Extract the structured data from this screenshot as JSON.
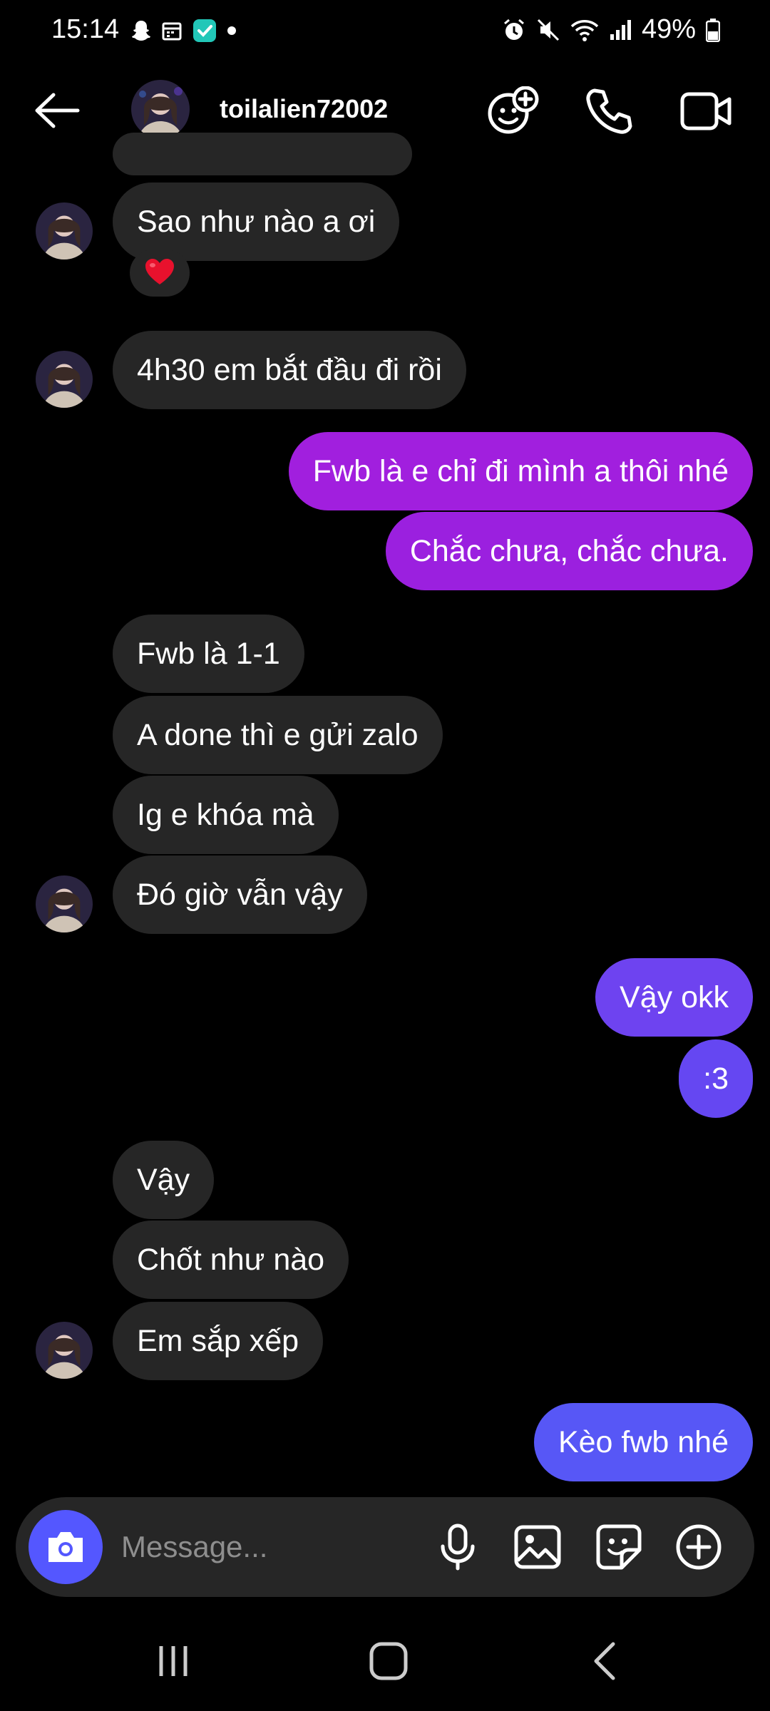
{
  "status_bar": {
    "time": "15:14",
    "battery": "49%",
    "left_icons": [
      "snapchat-icon",
      "calendar-icon",
      "check-app-icon",
      "dot-icon"
    ],
    "right_icons": [
      "alarm-icon",
      "mute-icon",
      "wifi-icon",
      "signal-icon",
      "battery-icon"
    ]
  },
  "header": {
    "username": "toilalien72002",
    "icons": [
      "back-arrow-icon",
      "add-people-icon",
      "phone-icon",
      "video-icon"
    ]
  },
  "colors": {
    "background": "#000000",
    "incoming_bubble": "#262626",
    "outgoing_purple": "#a11fde",
    "outgoing_violet": "#6e43f0",
    "outgoing_blue": "#5757f6",
    "camera_button": "#5457ff",
    "reaction": "#e8112d"
  },
  "messages": [
    {
      "direction": "in",
      "text": "Sao như nào a ơi",
      "reaction": "❤️"
    },
    {
      "direction": "in",
      "text": "4h30 em bắt đầu đi rồi"
    },
    {
      "direction": "out",
      "text": "Fwb là e chỉ đi mình a thôi nhé"
    },
    {
      "direction": "out",
      "text": "Chắc chưa, chắc chưa."
    },
    {
      "direction": "in",
      "text": "Fwb là 1-1"
    },
    {
      "direction": "in",
      "text": "A done thì e gửi zalo"
    },
    {
      "direction": "in",
      "text": "Ig e khóa mà"
    },
    {
      "direction": "in",
      "text": "Đó giờ vẫn vậy"
    },
    {
      "direction": "out",
      "text": "Vậy okk"
    },
    {
      "direction": "out",
      "text": ":3"
    },
    {
      "direction": "in",
      "text": "Vậy"
    },
    {
      "direction": "in",
      "text": "Chốt như nào"
    },
    {
      "direction": "in",
      "text": "Em sắp xếp"
    },
    {
      "direction": "out",
      "text": "Kèo fwb nhé"
    }
  ],
  "composer": {
    "placeholder": "Message...",
    "icons": [
      "camera-icon",
      "microphone-icon",
      "gallery-icon",
      "sticker-icon",
      "plus-circle-icon"
    ]
  },
  "navbar": {
    "icons": [
      "recent-apps-icon",
      "home-icon",
      "back-icon"
    ]
  }
}
